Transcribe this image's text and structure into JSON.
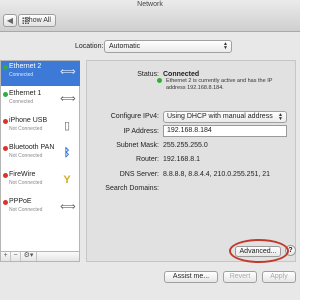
{
  "window": {
    "title": "Network"
  },
  "toolbar": {
    "back_label": "◀",
    "forward_label": "▶",
    "show_all_label": "Show All"
  },
  "location": {
    "label": "Location:",
    "value": "Automatic"
  },
  "services": [
    {
      "name": "Ethernet 2",
      "status": "Connected",
      "dot_color": "#2fae3b",
      "icon": "ethernet-icon",
      "glyph": "⟺",
      "selected": true
    },
    {
      "name": "Ethernet 1",
      "status": "Connected",
      "dot_color": "#2fae3b",
      "icon": "ethernet-icon",
      "glyph": "⟺",
      "selected": false
    },
    {
      "name": "iPhone USB",
      "status": "Not Connected",
      "dot_color": "#d9342b",
      "icon": "iphone-icon",
      "glyph": "▯",
      "selected": false
    },
    {
      "name": "Bluetooth PAN",
      "status": "Not Connected",
      "dot_color": "#d9342b",
      "icon": "bluetooth-icon",
      "glyph": "ᛒ",
      "selected": false
    },
    {
      "name": "FireWire",
      "status": "Not Connected",
      "dot_color": "#d9342b",
      "icon": "firewire-icon",
      "glyph": "Y",
      "selected": false
    },
    {
      "name": "PPPoE",
      "status": "Not Connected",
      "dot_color": "#d9342b",
      "icon": "pppoe-icon",
      "glyph": "⟺",
      "selected": false
    }
  ],
  "sidebar_tools": {
    "add": "+",
    "remove": "−",
    "action": "⚙▾"
  },
  "detail": {
    "status_label": "Status:",
    "status_value": "Connected",
    "status_detail": "Ethernet 2 is currently active and has the IP address 192.168.8.184.",
    "configure_label": "Configure IPv4:",
    "configure_value": "Using DHCP with manual address",
    "ip_label": "IP Address:",
    "ip_value": "192.168.8.184",
    "subnet_label": "Subnet Mask:",
    "subnet_value": "255.255.255.0",
    "router_label": "Router:",
    "router_value": "192.168.8.1",
    "dns_label": "DNS Server:",
    "dns_value": "8.8.8.8, 8.8.4.4, 210.0.255.251, 21",
    "search_label": "Search Domains:",
    "advanced_label": "Advanced...",
    "help_label": "?"
  },
  "bottom": {
    "assist_label": "Assist me...",
    "revert_label": "Revert",
    "apply_label": "Apply"
  },
  "colors": {
    "selection": "#3d79d6",
    "connected": "#2fae3b",
    "not_connected": "#d9342b",
    "highlight_ring": "#c0392b"
  }
}
